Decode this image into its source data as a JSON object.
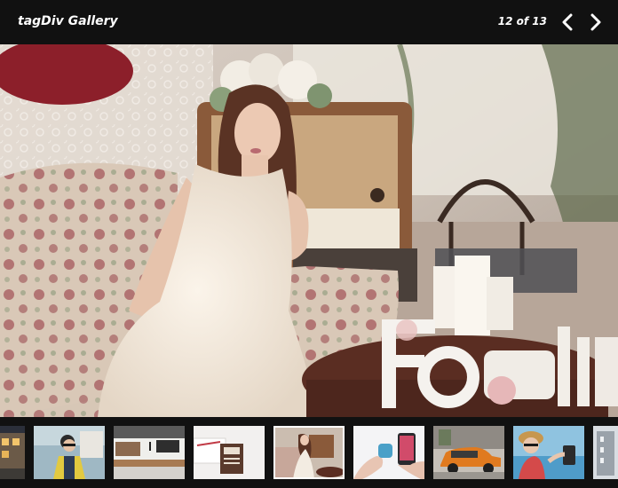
{
  "header": {
    "title": "tagDiv Gallery",
    "counter": "12 of 13"
  },
  "icons": {
    "prev": "chevron-left-icon",
    "next": "chevron-right-icon"
  },
  "main_image": {
    "description_icon": "photo-woman-white-dress-sofa-family-sign"
  },
  "thumbnails": [
    {
      "icon": "photo-building-night"
    },
    {
      "icon": "photo-woman-sunglasses-yellow-jacket"
    },
    {
      "icon": "photo-kitchen-interior"
    },
    {
      "icon": "photo-notebook-pen"
    },
    {
      "icon": "photo-woman-white-dress-sofa"
    },
    {
      "icon": "photo-hands-smartphones"
    },
    {
      "icon": "photo-orange-vintage-car"
    },
    {
      "icon": "photo-woman-selfie-sea"
    },
    {
      "icon": "photo-building-partial"
    }
  ],
  "colors": {
    "background": "#111111",
    "text": "#ffffff"
  },
  "active_thumbnail": 4
}
